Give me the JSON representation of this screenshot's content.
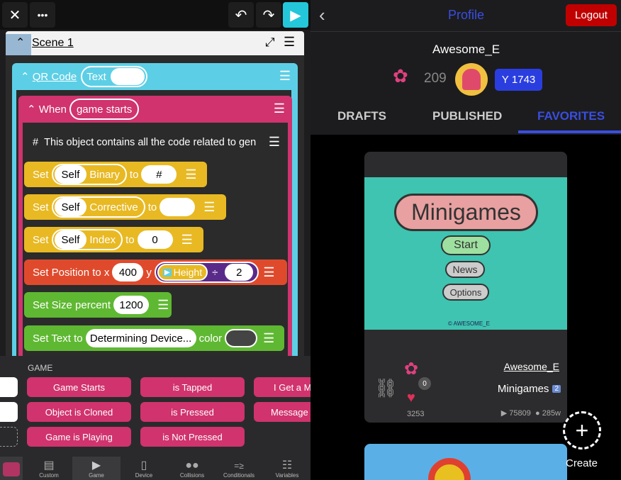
{
  "toolbar": {
    "close_icon": "✕",
    "more_icon": "•••",
    "undo_icon": "↶",
    "redo_icon": "↷",
    "play_icon": "▶"
  },
  "scene": {
    "title": "Scene 1",
    "expand_icon": "⤢",
    "menu_icon": "☰"
  },
  "object_block": {
    "label": "QR Code",
    "trait": "Text"
  },
  "rule_block": {
    "label": "When",
    "trigger": "game starts"
  },
  "comment": {
    "hash": "#",
    "text": "This object contains all the code related to gen"
  },
  "blocks": {
    "set1": {
      "set": "Set",
      "self": "Self",
      "var": "Binary",
      "to": "to",
      "value": "#"
    },
    "set2": {
      "set": "Set",
      "self": "Self",
      "var": "Corrective",
      "to": "to",
      "value": ""
    },
    "set3": {
      "set": "Set",
      "self": "Self",
      "var": "Index",
      "to": "to",
      "value": "0"
    },
    "position": {
      "label": "Set Position to x",
      "x": "400",
      "y": "y",
      "height_label": "Height",
      "divide": "÷",
      "divisor": "2"
    },
    "size": {
      "label": "Set Size percent",
      "value": "1200"
    },
    "text": {
      "label": "Set Text to",
      "value": "Determining Device...",
      "color": "color"
    }
  },
  "palette": {
    "section": "GAME",
    "buttons": [
      "Game Starts",
      "is Tapped",
      "I Get a M",
      "Object is Cloned",
      "is Pressed",
      "Message M",
      "Game is Playing",
      "is Not Pressed"
    ]
  },
  "bottom_tabs": [
    "Custom",
    "Game",
    "Device",
    "Collisions",
    "Conditionals",
    "Variables"
  ],
  "profile": {
    "back_icon": "‹",
    "title": "Profile",
    "logout": "Logout",
    "username": "Awesome_E",
    "plants": "209",
    "cups": "1743",
    "tabs": [
      "DRAFTS",
      "PUBLISHED",
      "FAVORITES"
    ],
    "colors": {
      "accent": "#3a4ee0",
      "logout": "#c00000",
      "title": "#3a4ee0"
    }
  },
  "project_card": {
    "thumb_title": "Minigames",
    "thumb_buttons": [
      "Start",
      "News",
      "Options"
    ],
    "thumb_watermark": "© AWESOME_E",
    "author": "Awesome_E",
    "name": "Minigames",
    "badge": "2",
    "plant_count": "0",
    "likes": "3253",
    "plays": "75809",
    "age": "285w"
  },
  "create": {
    "label": "Create"
  }
}
